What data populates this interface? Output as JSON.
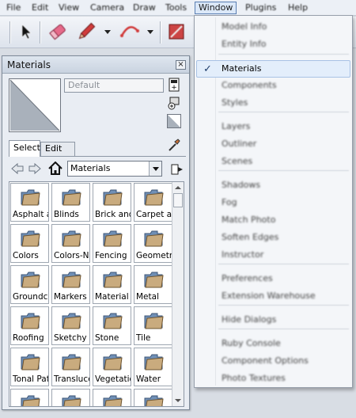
{
  "menubar": {
    "items": [
      {
        "label": "File"
      },
      {
        "label": "Edit"
      },
      {
        "label": "View"
      },
      {
        "label": "Camera"
      },
      {
        "label": "Draw"
      },
      {
        "label": "Tools"
      },
      {
        "label": "Window"
      },
      {
        "label": "Plugins"
      },
      {
        "label": "Help"
      }
    ],
    "active": "Window"
  },
  "toolbar": {
    "icons": [
      "select-arrow-icon",
      "eraser-icon",
      "pencil-icon",
      "arc-icon",
      "paint-bucket-icon"
    ]
  },
  "materials": {
    "title": "Materials",
    "close_symbol": "×",
    "name_value": "Default",
    "tabs": [
      {
        "label": "Select"
      },
      {
        "label": "Edit"
      }
    ],
    "library": "Materials",
    "items": [
      {
        "label": "Asphalt and"
      },
      {
        "label": "Blinds"
      },
      {
        "label": "Brick and Cl"
      },
      {
        "label": "Carpet and"
      },
      {
        "label": "Colors"
      },
      {
        "label": "Colors-Named"
      },
      {
        "label": "Fencing"
      },
      {
        "label": "Geometric"
      },
      {
        "label": "Groundcover"
      },
      {
        "label": "Markers"
      },
      {
        "label": "Material Sa"
      },
      {
        "label": "Metal"
      },
      {
        "label": "Roofing"
      },
      {
        "label": "Sketchy"
      },
      {
        "label": "Stone"
      },
      {
        "label": "Tile"
      },
      {
        "label": "Tonal Patt"
      },
      {
        "label": "Translucent"
      },
      {
        "label": "Vegetation"
      },
      {
        "label": "Water"
      },
      {
        "label": ""
      },
      {
        "label": ""
      },
      {
        "label": ""
      },
      {
        "label": ""
      }
    ]
  },
  "window_menu": {
    "items": [
      {
        "label": "Model Info"
      },
      {
        "label": "Entity Info"
      },
      {
        "label": "Materials",
        "checked": true
      },
      {
        "label": "Components"
      },
      {
        "label": "Styles"
      },
      {
        "label": "Layers"
      },
      {
        "label": "Outliner"
      },
      {
        "label": "Scenes"
      },
      {
        "label": "Shadows"
      },
      {
        "label": "Fog"
      },
      {
        "label": "Match Photo"
      },
      {
        "label": "Soften Edges"
      },
      {
        "label": "Instructor"
      },
      {
        "label": "Preferences"
      },
      {
        "label": "Extension Warehouse"
      },
      {
        "label": "Hide Dialogs"
      },
      {
        "label": "Ruby Console"
      },
      {
        "label": "Component Options"
      },
      {
        "label": "Photo Textures"
      }
    ],
    "check_symbol": "✓"
  },
  "colors": {
    "accent": "#5a7fb3",
    "folder": "#c9ab7e",
    "preview_fill": "#a9b1bb"
  }
}
